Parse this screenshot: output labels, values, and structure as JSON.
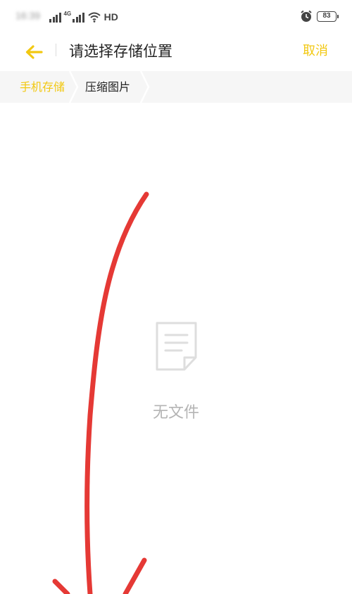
{
  "status_bar": {
    "time": "16:39",
    "network": "4G",
    "connection": "HD",
    "battery": "83",
    "icons": [
      "signal-icon",
      "signal-4g-icon",
      "wifi-icon",
      "alarm-icon",
      "battery-icon"
    ]
  },
  "header": {
    "title": "请选择存储位置",
    "cancel_label": "取消",
    "back_icon": "back-arrow-icon"
  },
  "breadcrumb": {
    "items": [
      {
        "label": "手机存储"
      },
      {
        "label": "压缩图片"
      }
    ]
  },
  "empty_state": {
    "icon": "document-icon",
    "text": "无文件"
  },
  "colors": {
    "accent": "#f2c811",
    "annotation": "#e53935",
    "breadcrumb_bg": "#f6f6f6",
    "empty_text": "#b4b4b4"
  }
}
